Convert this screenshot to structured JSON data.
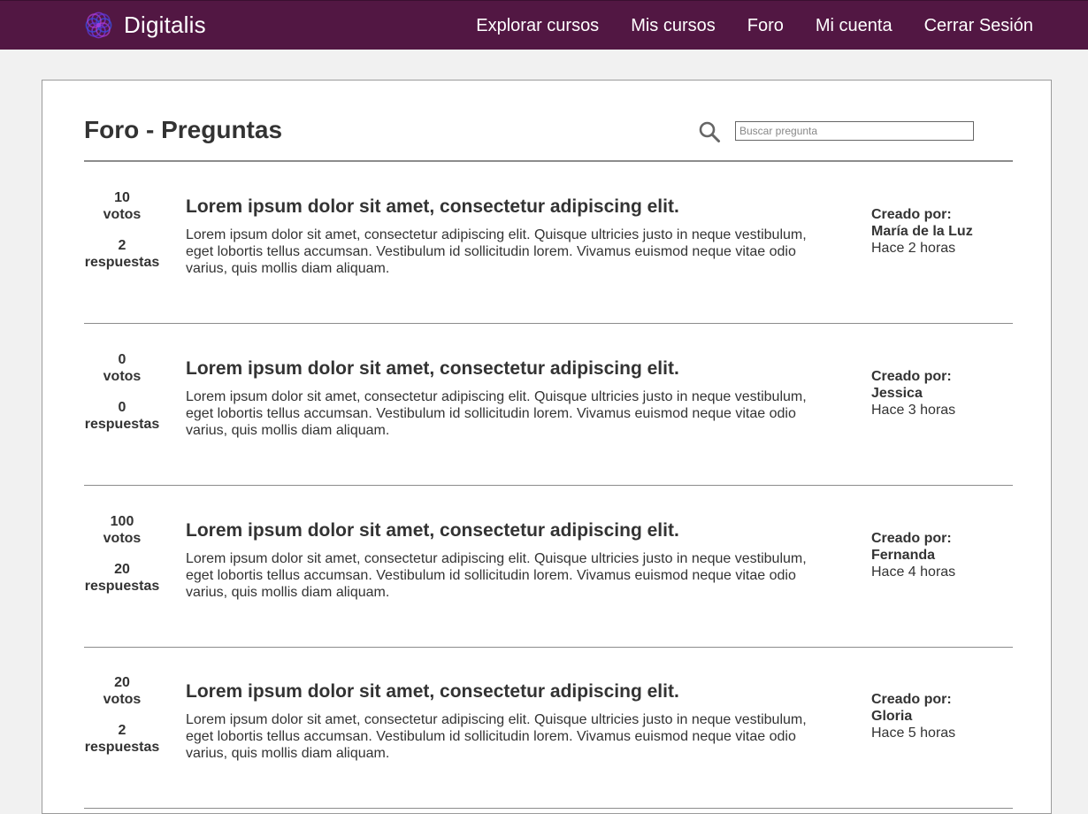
{
  "app": {
    "brand": "Digitalis",
    "colors": {
      "navbar": "#521743",
      "logo_primary": "#7b2fd1",
      "logo_secondary": "#3a4bd8"
    }
  },
  "nav": {
    "items": [
      {
        "label": "Explorar cursos"
      },
      {
        "label": "Mis cursos"
      },
      {
        "label": "Foro"
      },
      {
        "label": "Mi cuenta"
      },
      {
        "label": "Cerrar Sesión"
      }
    ]
  },
  "page": {
    "title": "Foro - Preguntas",
    "search": {
      "placeholder": "Buscar pregunta",
      "value": "",
      "icon": "search-icon"
    }
  },
  "questions": [
    {
      "votes": "10",
      "votes_label": "votos",
      "answers": "2",
      "answers_label": "respuestas",
      "title": "Lorem ipsum dolor sit amet, consectetur adipiscing elit.",
      "text": "Lorem ipsum dolor sit amet, consectetur adipiscing elit. Quisque ultricies justo in neque vestibulum, eget lobortis tellus accumsan. Vestibulum id sollicitudin lorem. Vivamus euismod neque vitae odio varius, quis mollis diam aliquam.",
      "author_label": "Creado por:",
      "author": "María de la Luz",
      "time": "Hace 2 horas"
    },
    {
      "votes": "0",
      "votes_label": "votos",
      "answers": "0",
      "answers_label": "respuestas",
      "title": "Lorem ipsum dolor sit amet, consectetur adipiscing elit.",
      "text": "Lorem ipsum dolor sit amet, consectetur adipiscing elit. Quisque ultricies justo in neque vestibulum, eget lobortis tellus accumsan. Vestibulum id sollicitudin lorem. Vivamus euismod neque vitae odio varius, quis mollis diam aliquam.",
      "author_label": "Creado por:",
      "author": "Jessica",
      "time": "Hace 3 horas"
    },
    {
      "votes": "100",
      "votes_label": "votos",
      "answers": "20",
      "answers_label": "respuestas",
      "title": "Lorem ipsum dolor sit amet, consectetur adipiscing elit.",
      "text": "Lorem ipsum dolor sit amet, consectetur adipiscing elit. Quisque ultricies justo in neque vestibulum, eget lobortis tellus accumsan. Vestibulum id sollicitudin lorem. Vivamus euismod neque vitae odio varius, quis mollis diam aliquam.",
      "author_label": "Creado por:",
      "author": "Fernanda",
      "time": "Hace 4 horas"
    },
    {
      "votes": "20",
      "votes_label": "votos",
      "answers": "2",
      "answers_label": "respuestas",
      "title": "Lorem ipsum dolor sit amet, consectetur adipiscing elit.",
      "text": "Lorem ipsum dolor sit amet, consectetur adipiscing elit. Quisque ultricies justo in neque vestibulum, eget lobortis tellus accumsan. Vestibulum id sollicitudin lorem. Vivamus euismod neque vitae odio varius, quis mollis diam aliquam.",
      "author_label": "Creado por:",
      "author": "Gloria",
      "time": "Hace 5 horas"
    }
  ]
}
